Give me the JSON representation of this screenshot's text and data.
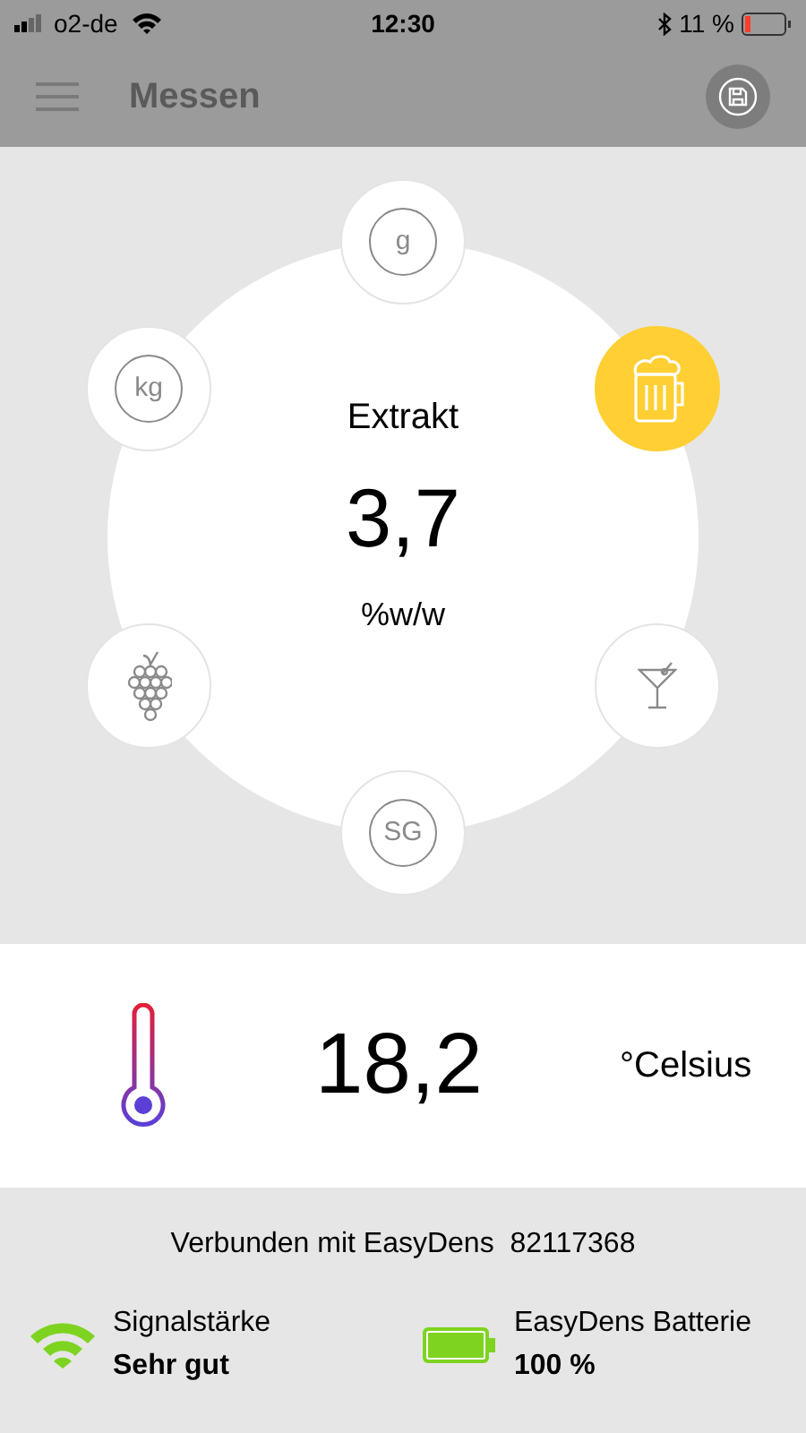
{
  "status_bar": {
    "carrier": "o2-de",
    "time": "12:30",
    "battery": "11 %"
  },
  "header": {
    "title": "Messen"
  },
  "dial": {
    "label": "Extrakt",
    "value": "3,7",
    "unit": "%w/w",
    "modes": [
      {
        "kind": "text",
        "text": "g",
        "selected": false
      },
      {
        "kind": "beer",
        "selected": true
      },
      {
        "kind": "cocktail",
        "selected": false
      },
      {
        "kind": "text",
        "text": "SG",
        "selected": false
      },
      {
        "kind": "grapes",
        "selected": false
      },
      {
        "kind": "text",
        "text": "kg",
        "selected": false
      }
    ]
  },
  "temperature": {
    "value": "18,2",
    "unit": "°Celsius"
  },
  "footer": {
    "connection": "Verbunden mit EasyDens  82117368",
    "signal": {
      "label": "Signalstärke",
      "value": "Sehr gut"
    },
    "battery": {
      "label": "EasyDens Batterie",
      "value": "100 %"
    }
  }
}
